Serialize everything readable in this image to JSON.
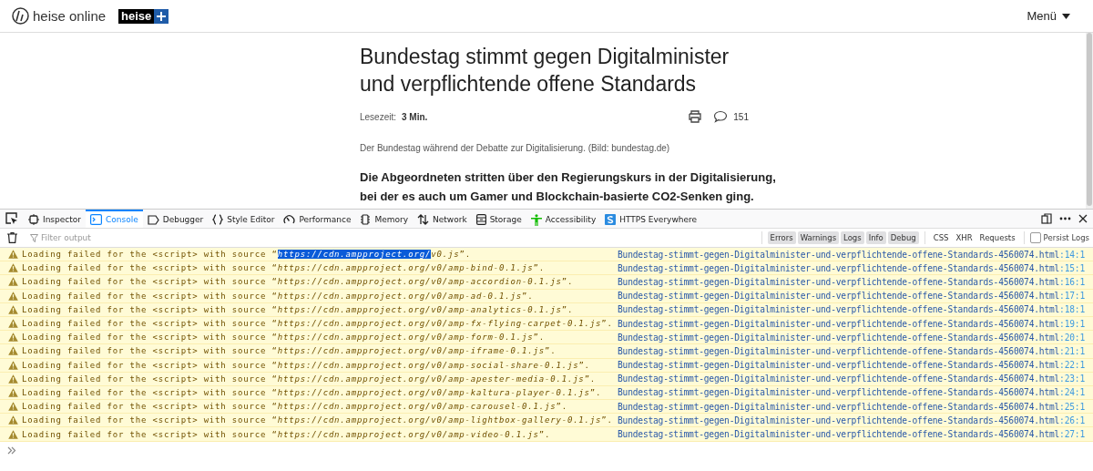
{
  "site_header": {
    "logo_text": "heise online",
    "plus_badge": "heise",
    "menu_label": "Menü"
  },
  "article": {
    "title_lines": [
      "Bundestag stimmt gegen Digitalminister",
      "und verpflichtende offene Standards"
    ],
    "reading_time_label": "Lesezeit:",
    "reading_time": "3 Min.",
    "comment_count": "151",
    "caption": "Der Bundestag während der Debatte zur Digitalisierung. (Bild: bundestag.de)",
    "lead_lines": [
      "Die Abgeordneten stritten über den Regierungskurs in der Digitalisierung,",
      "bei der es auch um Gamer und Blockchain-basierte CO2-Senken ging."
    ]
  },
  "devtools": {
    "tabs": [
      {
        "kind": "inspector",
        "label": "Inspector",
        "selected": false
      },
      {
        "kind": "console",
        "label": "Console",
        "selected": true
      },
      {
        "kind": "debugger",
        "label": "Debugger",
        "selected": false
      },
      {
        "kind": "style",
        "label": "Style Editor",
        "selected": false
      },
      {
        "kind": "performance",
        "label": "Performance",
        "selected": false
      },
      {
        "kind": "memory",
        "label": "Memory",
        "selected": false
      },
      {
        "kind": "network",
        "label": "Network",
        "selected": false
      },
      {
        "kind": "storage",
        "label": "Storage",
        "selected": false
      },
      {
        "kind": "accessibility",
        "label": "Accessibility",
        "selected": false
      },
      {
        "kind": "https",
        "label": "HTTPS Everywhere",
        "selected": false
      }
    ],
    "filter_placeholder": "Filter output",
    "level_filters": [
      {
        "label": "Errors",
        "selected": true
      },
      {
        "label": "Warnings",
        "selected": true
      },
      {
        "label": "Logs",
        "selected": true
      },
      {
        "label": "Info",
        "selected": true
      },
      {
        "label": "Debug",
        "selected": true
      }
    ],
    "type_filters": [
      {
        "label": "CSS",
        "selected": false
      },
      {
        "label": "XHR",
        "selected": false
      },
      {
        "label": "Requests",
        "selected": false
      }
    ],
    "persist_logs": {
      "label": "Persist Logs",
      "checked": false
    },
    "messages": [
      {
        "prefix": "Loading failed for the <script> with source “",
        "url": [
          {
            "text": "https://cdn.ampproject.org/",
            "selected": true
          },
          {
            "text": "v0.js",
            "selected": false
          }
        ],
        "suffix": "”.",
        "file": "Bundestag-stimmt-gegen-Digitalminister-und-verpflichtende-offene-Standards-4560074.html",
        "position": ":14:1"
      },
      {
        "prefix": "Loading failed for the <script> with source “",
        "url": [
          {
            "text": "https://cdn.ampproject.org/v0/amp-bind-0.1.js",
            "selected": false
          }
        ],
        "suffix": "”.",
        "file": "Bundestag-stimmt-gegen-Digitalminister-und-verpflichtende-offene-Standards-4560074.html",
        "position": ":15:1"
      },
      {
        "prefix": "Loading failed for the <script> with source “",
        "url": [
          {
            "text": "https://cdn.ampproject.org/v0/amp-accordion-0.1.js",
            "selected": false
          }
        ],
        "suffix": "”.",
        "file": "Bundestag-stimmt-gegen-Digitalminister-und-verpflichtende-offene-Standards-4560074.html",
        "position": ":16:1"
      },
      {
        "prefix": "Loading failed for the <script> with source “",
        "url": [
          {
            "text": "https://cdn.ampproject.org/v0/amp-ad-0.1.js",
            "selected": false
          }
        ],
        "suffix": "”.",
        "file": "Bundestag-stimmt-gegen-Digitalminister-und-verpflichtende-offene-Standards-4560074.html",
        "position": ":17:1"
      },
      {
        "prefix": "Loading failed for the <script> with source “",
        "url": [
          {
            "text": "https://cdn.ampproject.org/v0/amp-analytics-0.1.js",
            "selected": false
          }
        ],
        "suffix": "”.",
        "file": "Bundestag-stimmt-gegen-Digitalminister-und-verpflichtende-offene-Standards-4560074.html",
        "position": ":18:1"
      },
      {
        "prefix": "Loading failed for the <script> with source “",
        "url": [
          {
            "text": "https://cdn.ampproject.org/v0/amp-fx-flying-carpet-0.1.js",
            "selected": false
          }
        ],
        "suffix": "”.",
        "file": "Bundestag-stimmt-gegen-Digitalminister-und-verpflichtende-offene-Standards-4560074.html",
        "position": ":19:1"
      },
      {
        "prefix": "Loading failed for the <script> with source “",
        "url": [
          {
            "text": "https://cdn.ampproject.org/v0/amp-form-0.1.js",
            "selected": false
          }
        ],
        "suffix": "”.",
        "file": "Bundestag-stimmt-gegen-Digitalminister-und-verpflichtende-offene-Standards-4560074.html",
        "position": ":20:1"
      },
      {
        "prefix": "Loading failed for the <script> with source “",
        "url": [
          {
            "text": "https://cdn.ampproject.org/v0/amp-iframe-0.1.js",
            "selected": false
          }
        ],
        "suffix": "”.",
        "file": "Bundestag-stimmt-gegen-Digitalminister-und-verpflichtende-offene-Standards-4560074.html",
        "position": ":21:1"
      },
      {
        "prefix": "Loading failed for the <script> with source “",
        "url": [
          {
            "text": "https://cdn.ampproject.org/v0/amp-social-share-0.1.js",
            "selected": false
          }
        ],
        "suffix": "”.",
        "file": "Bundestag-stimmt-gegen-Digitalminister-und-verpflichtende-offene-Standards-4560074.html",
        "position": ":22:1"
      },
      {
        "prefix": "Loading failed for the <script> with source “",
        "url": [
          {
            "text": "https://cdn.ampproject.org/v0/amp-apester-media-0.1.js",
            "selected": false
          }
        ],
        "suffix": "”.",
        "file": "Bundestag-stimmt-gegen-Digitalminister-und-verpflichtende-offene-Standards-4560074.html",
        "position": ":23:1"
      },
      {
        "prefix": "Loading failed for the <script> with source “",
        "url": [
          {
            "text": "https://cdn.ampproject.org/v0/amp-kaltura-player-0.1.js",
            "selected": false
          }
        ],
        "suffix": "”.",
        "file": "Bundestag-stimmt-gegen-Digitalminister-und-verpflichtende-offene-Standards-4560074.html",
        "position": ":24:1"
      },
      {
        "prefix": "Loading failed for the <script> with source “",
        "url": [
          {
            "text": "https://cdn.ampproject.org/v0/amp-carousel-0.1.js",
            "selected": false
          }
        ],
        "suffix": "”.",
        "file": "Bundestag-stimmt-gegen-Digitalminister-und-verpflichtende-offene-Standards-4560074.html",
        "position": ":25:1"
      },
      {
        "prefix": "Loading failed for the <script> with source “",
        "url": [
          {
            "text": "https://cdn.ampproject.org/v0/amp-lightbox-gallery-0.1.js",
            "selected": false
          }
        ],
        "suffix": "”.",
        "file": "Bundestag-stimmt-gegen-Digitalminister-und-verpflichtende-offene-Standards-4560074.html",
        "position": ":26:1"
      },
      {
        "prefix": "Loading failed for the <script> with source “",
        "url": [
          {
            "text": "https://cdn.ampproject.org/v0/amp-video-0.1.js",
            "selected": false
          }
        ],
        "suffix": "”.",
        "file": "Bundestag-stimmt-gegen-Digitalminister-und-verpflichtende-offene-Standards-4560074.html",
        "position": ":27:1"
      }
    ]
  }
}
